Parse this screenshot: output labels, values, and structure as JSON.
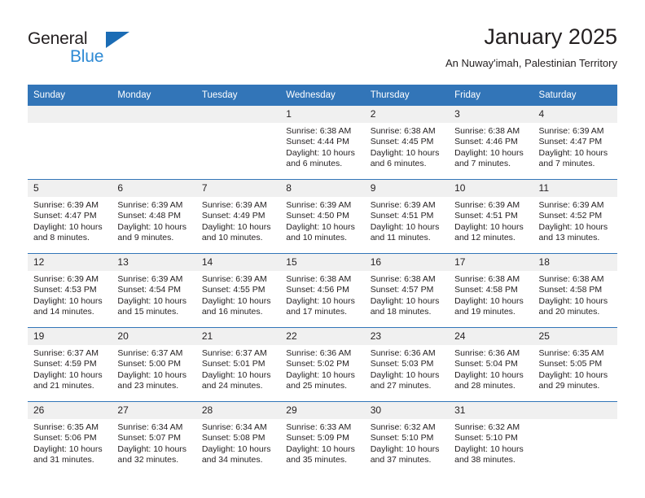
{
  "brand": {
    "name_top": "General",
    "name_bottom": "Blue",
    "triangle_color": "#1b6cb5",
    "blue_color": "#2e8ad4"
  },
  "header": {
    "title": "January 2025",
    "subtitle": "An Nuway'imah, Palestinian Territory"
  },
  "theme": {
    "header_bg": "#3275b8",
    "daynum_bg": "#f0f0f0",
    "text": "#231f20"
  },
  "weekdays": [
    "Sunday",
    "Monday",
    "Tuesday",
    "Wednesday",
    "Thursday",
    "Friday",
    "Saturday"
  ],
  "labels": {
    "sunrise": "Sunrise:",
    "sunset": "Sunset:",
    "daylight": "Daylight:"
  },
  "weeks": [
    [
      {
        "day": "",
        "sunrise": "",
        "sunset": "",
        "daylight": ""
      },
      {
        "day": "",
        "sunrise": "",
        "sunset": "",
        "daylight": ""
      },
      {
        "day": "",
        "sunrise": "",
        "sunset": "",
        "daylight": ""
      },
      {
        "day": "1",
        "sunrise": "Sunrise: 6:38 AM",
        "sunset": "Sunset: 4:44 PM",
        "daylight": "Daylight: 10 hours and 6 minutes."
      },
      {
        "day": "2",
        "sunrise": "Sunrise: 6:38 AM",
        "sunset": "Sunset: 4:45 PM",
        "daylight": "Daylight: 10 hours and 6 minutes."
      },
      {
        "day": "3",
        "sunrise": "Sunrise: 6:38 AM",
        "sunset": "Sunset: 4:46 PM",
        "daylight": "Daylight: 10 hours and 7 minutes."
      },
      {
        "day": "4",
        "sunrise": "Sunrise: 6:39 AM",
        "sunset": "Sunset: 4:47 PM",
        "daylight": "Daylight: 10 hours and 7 minutes."
      }
    ],
    [
      {
        "day": "5",
        "sunrise": "Sunrise: 6:39 AM",
        "sunset": "Sunset: 4:47 PM",
        "daylight": "Daylight: 10 hours and 8 minutes."
      },
      {
        "day": "6",
        "sunrise": "Sunrise: 6:39 AM",
        "sunset": "Sunset: 4:48 PM",
        "daylight": "Daylight: 10 hours and 9 minutes."
      },
      {
        "day": "7",
        "sunrise": "Sunrise: 6:39 AM",
        "sunset": "Sunset: 4:49 PM",
        "daylight": "Daylight: 10 hours and 10 minutes."
      },
      {
        "day": "8",
        "sunrise": "Sunrise: 6:39 AM",
        "sunset": "Sunset: 4:50 PM",
        "daylight": "Daylight: 10 hours and 10 minutes."
      },
      {
        "day": "9",
        "sunrise": "Sunrise: 6:39 AM",
        "sunset": "Sunset: 4:51 PM",
        "daylight": "Daylight: 10 hours and 11 minutes."
      },
      {
        "day": "10",
        "sunrise": "Sunrise: 6:39 AM",
        "sunset": "Sunset: 4:51 PM",
        "daylight": "Daylight: 10 hours and 12 minutes."
      },
      {
        "day": "11",
        "sunrise": "Sunrise: 6:39 AM",
        "sunset": "Sunset: 4:52 PM",
        "daylight": "Daylight: 10 hours and 13 minutes."
      }
    ],
    [
      {
        "day": "12",
        "sunrise": "Sunrise: 6:39 AM",
        "sunset": "Sunset: 4:53 PM",
        "daylight": "Daylight: 10 hours and 14 minutes."
      },
      {
        "day": "13",
        "sunrise": "Sunrise: 6:39 AM",
        "sunset": "Sunset: 4:54 PM",
        "daylight": "Daylight: 10 hours and 15 minutes."
      },
      {
        "day": "14",
        "sunrise": "Sunrise: 6:39 AM",
        "sunset": "Sunset: 4:55 PM",
        "daylight": "Daylight: 10 hours and 16 minutes."
      },
      {
        "day": "15",
        "sunrise": "Sunrise: 6:38 AM",
        "sunset": "Sunset: 4:56 PM",
        "daylight": "Daylight: 10 hours and 17 minutes."
      },
      {
        "day": "16",
        "sunrise": "Sunrise: 6:38 AM",
        "sunset": "Sunset: 4:57 PM",
        "daylight": "Daylight: 10 hours and 18 minutes."
      },
      {
        "day": "17",
        "sunrise": "Sunrise: 6:38 AM",
        "sunset": "Sunset: 4:58 PM",
        "daylight": "Daylight: 10 hours and 19 minutes."
      },
      {
        "day": "18",
        "sunrise": "Sunrise: 6:38 AM",
        "sunset": "Sunset: 4:58 PM",
        "daylight": "Daylight: 10 hours and 20 minutes."
      }
    ],
    [
      {
        "day": "19",
        "sunrise": "Sunrise: 6:37 AM",
        "sunset": "Sunset: 4:59 PM",
        "daylight": "Daylight: 10 hours and 21 minutes."
      },
      {
        "day": "20",
        "sunrise": "Sunrise: 6:37 AM",
        "sunset": "Sunset: 5:00 PM",
        "daylight": "Daylight: 10 hours and 23 minutes."
      },
      {
        "day": "21",
        "sunrise": "Sunrise: 6:37 AM",
        "sunset": "Sunset: 5:01 PM",
        "daylight": "Daylight: 10 hours and 24 minutes."
      },
      {
        "day": "22",
        "sunrise": "Sunrise: 6:36 AM",
        "sunset": "Sunset: 5:02 PM",
        "daylight": "Daylight: 10 hours and 25 minutes."
      },
      {
        "day": "23",
        "sunrise": "Sunrise: 6:36 AM",
        "sunset": "Sunset: 5:03 PM",
        "daylight": "Daylight: 10 hours and 27 minutes."
      },
      {
        "day": "24",
        "sunrise": "Sunrise: 6:36 AM",
        "sunset": "Sunset: 5:04 PM",
        "daylight": "Daylight: 10 hours and 28 minutes."
      },
      {
        "day": "25",
        "sunrise": "Sunrise: 6:35 AM",
        "sunset": "Sunset: 5:05 PM",
        "daylight": "Daylight: 10 hours and 29 minutes."
      }
    ],
    [
      {
        "day": "26",
        "sunrise": "Sunrise: 6:35 AM",
        "sunset": "Sunset: 5:06 PM",
        "daylight": "Daylight: 10 hours and 31 minutes."
      },
      {
        "day": "27",
        "sunrise": "Sunrise: 6:34 AM",
        "sunset": "Sunset: 5:07 PM",
        "daylight": "Daylight: 10 hours and 32 minutes."
      },
      {
        "day": "28",
        "sunrise": "Sunrise: 6:34 AM",
        "sunset": "Sunset: 5:08 PM",
        "daylight": "Daylight: 10 hours and 34 minutes."
      },
      {
        "day": "29",
        "sunrise": "Sunrise: 6:33 AM",
        "sunset": "Sunset: 5:09 PM",
        "daylight": "Daylight: 10 hours and 35 minutes."
      },
      {
        "day": "30",
        "sunrise": "Sunrise: 6:32 AM",
        "sunset": "Sunset: 5:10 PM",
        "daylight": "Daylight: 10 hours and 37 minutes."
      },
      {
        "day": "31",
        "sunrise": "Sunrise: 6:32 AM",
        "sunset": "Sunset: 5:10 PM",
        "daylight": "Daylight: 10 hours and 38 minutes."
      },
      {
        "day": "",
        "sunrise": "",
        "sunset": "",
        "daylight": ""
      }
    ]
  ]
}
